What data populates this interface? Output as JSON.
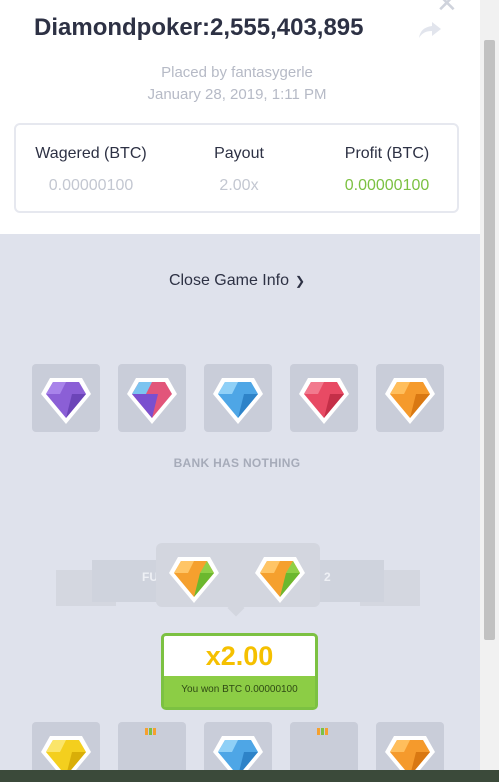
{
  "bet": {
    "title": "Diamondpoker:2,555,403,895",
    "placed_by": "Placed by fantasygerle",
    "date": "January 28, 2019, 1:11 PM"
  },
  "stats": {
    "wagered_label": "Wagered (BTC)",
    "wagered_value": "0.00000100",
    "payout_label": "Payout",
    "payout_value": "2.00x",
    "profit_label": "Profit (BTC)",
    "profit_value": "0.00000100"
  },
  "game_info_toggle": "Close Game Info",
  "dealer": {
    "gems": [
      "purple",
      "pink-purple",
      "blue",
      "red",
      "orange"
    ],
    "status": "BANK HAS NOTHING"
  },
  "ribbon": {
    "left_text": "FU",
    "right_text": "2"
  },
  "popover_gems": [
    "orange-green",
    "orange-green"
  ],
  "result": {
    "multiplier": "x2.00",
    "message": "You won BTC 0.00000100"
  },
  "player": {
    "gems": [
      "yellow",
      "hidden",
      "blue",
      "hidden",
      "orange"
    ]
  },
  "colors": {
    "accent_green": "#7cc142",
    "multiplier_yellow": "#f5c000",
    "title_dark": "#2d3144"
  },
  "icons": {
    "share": "share-icon",
    "close": "close-icon",
    "chevron": "chevron-down-icon"
  }
}
